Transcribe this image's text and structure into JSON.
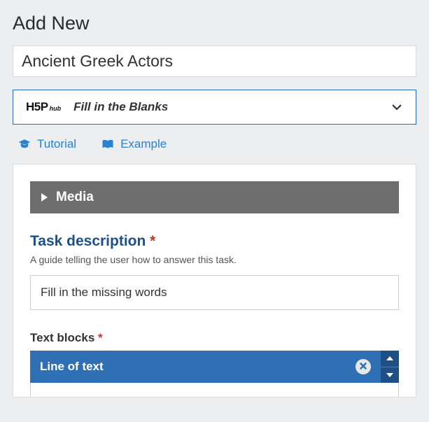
{
  "header": {
    "title": "Add New"
  },
  "title_field": {
    "value": "Ancient Greek Actors"
  },
  "type_selector": {
    "logo_main": "H5P",
    "logo_sub": "hub",
    "label": "Fill in the Blanks"
  },
  "links": {
    "tutorial": "Tutorial",
    "example": "Example"
  },
  "panels": {
    "media": {
      "title": "Media"
    }
  },
  "task_description": {
    "label": "Task description",
    "required_marker": "*",
    "help": "A guide telling the user how to answer this task.",
    "value": "Fill in the missing words"
  },
  "text_blocks": {
    "label": "Text blocks",
    "required_marker": "*",
    "items": [
      {
        "title": "Line of text"
      }
    ]
  }
}
